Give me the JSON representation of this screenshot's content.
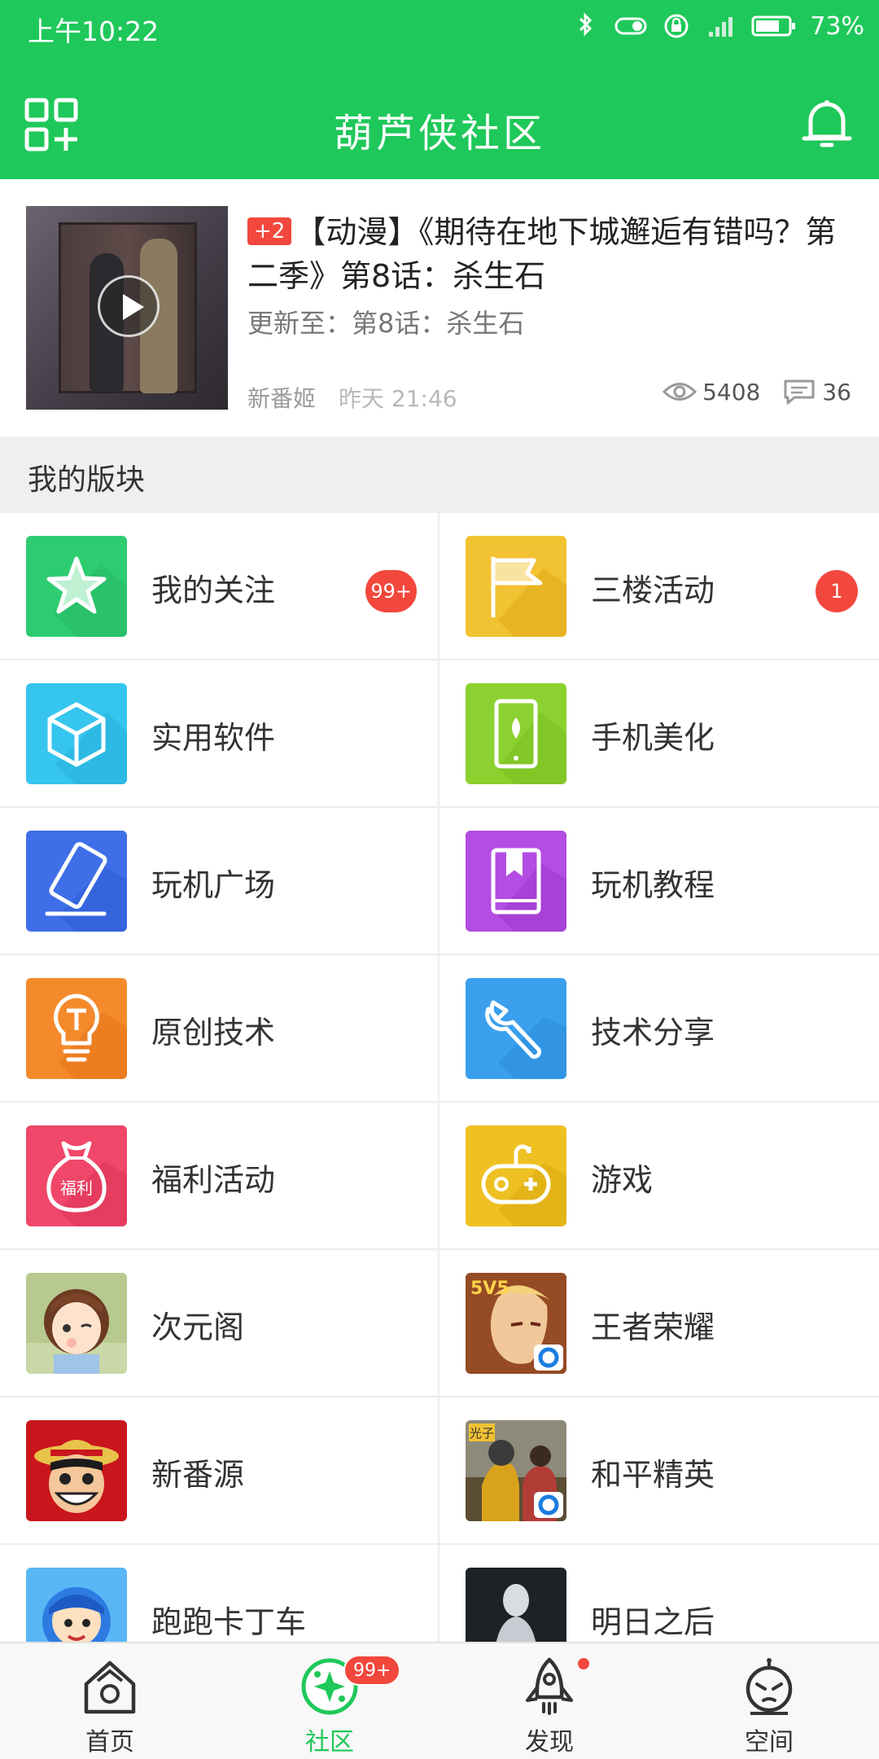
{
  "status_bar": {
    "time": "上午10:22",
    "battery": "73%",
    "icons": [
      "bluetooth-icon",
      "toggle-icon",
      "lock-rotation-icon",
      "signal-icon",
      "battery-icon"
    ]
  },
  "header": {
    "title": "葫芦侠社区",
    "left_icon": "grid-add-icon",
    "right_icon": "bell-icon",
    "background": "#1fc85a"
  },
  "feature": {
    "badge": "+2",
    "title": "【动漫】《期待在地下城邂逅有错吗？第二季》第8话：杀生石",
    "subtitle": "更新至：第8话：杀生石",
    "author": "新番姬",
    "time": "昨天 21:46",
    "views": "5408",
    "comments": "36"
  },
  "section": {
    "title": "我的版块"
  },
  "boards": [
    {
      "label": "我的关注",
      "icon": "star-icon",
      "color": "#2ecc71",
      "badge": "99+"
    },
    {
      "label": "三楼活动",
      "icon": "flag-icon",
      "color": "#f1c232",
      "badge": "1"
    },
    {
      "label": "实用软件",
      "icon": "cube-icon",
      "color": "#36c5ee",
      "badge": ""
    },
    {
      "label": "手机美化",
      "icon": "phone-leaf-icon",
      "color": "#8bd12f",
      "badge": ""
    },
    {
      "label": "玩机广场",
      "icon": "tilted-phone-icon",
      "color": "#3f6fe8",
      "badge": ""
    },
    {
      "label": "玩机教程",
      "icon": "book-icon",
      "color": "#b34de3",
      "badge": ""
    },
    {
      "label": "原创技术",
      "icon": "lightbulb-icon",
      "color": "#f58a2c",
      "badge": ""
    },
    {
      "label": "技术分享",
      "icon": "wrench-icon",
      "color": "#3aa0ee",
      "badge": ""
    },
    {
      "label": "福利活动",
      "icon": "money-bag-icon",
      "color": "#f0476a",
      "badge": "",
      "icon_text": "福利"
    },
    {
      "label": "游戏",
      "icon": "gamepad-icon",
      "color": "#eec022",
      "badge": ""
    },
    {
      "label": "次元阁",
      "icon": "anime-girl-icon",
      "color": "#f3d9c4",
      "badge": ""
    },
    {
      "label": "王者荣耀",
      "icon": "honor-of-kings-icon",
      "color": "#7a2a1e",
      "badge": "",
      "icon_text": "5V5"
    },
    {
      "label": "新番源",
      "icon": "luffy-icon",
      "color": "#c9161d",
      "badge": ""
    },
    {
      "label": "和平精英",
      "icon": "peace-elite-icon",
      "color": "#6b5a3a",
      "badge": "",
      "icon_text": "光子"
    },
    {
      "label": "跑跑卡丁车",
      "icon": "kart-rider-icon",
      "color": "#2d7be0",
      "badge": ""
    },
    {
      "label": "明日之后",
      "icon": "lifeafter-icon",
      "color": "#2a2d33",
      "badge": ""
    }
  ],
  "bottom_nav": [
    {
      "label": "首页",
      "icon": "house-icon",
      "active": false,
      "badge": ""
    },
    {
      "label": "社区",
      "icon": "community-icon",
      "active": true,
      "badge": "99+"
    },
    {
      "label": "发现",
      "icon": "rocket-icon",
      "active": false,
      "badge": "dot"
    },
    {
      "label": "空间",
      "icon": "alien-face-icon",
      "active": false,
      "badge": ""
    }
  ]
}
